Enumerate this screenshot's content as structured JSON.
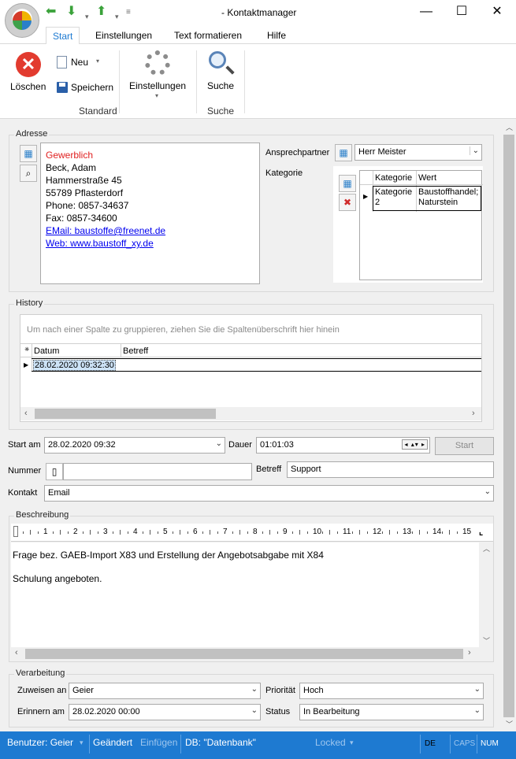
{
  "window": {
    "title": "- Kontaktmanager",
    "minimize": "—",
    "maximize": "☐",
    "close": "✕"
  },
  "quick_access": {
    "back": "⬅",
    "forward": "⬇",
    "up": "⬆",
    "more1": "▾",
    "more2": "▾"
  },
  "ribbon": {
    "tabs": [
      "Start",
      "Einstellungen",
      "Text formatieren",
      "Hilfe"
    ],
    "buttons": {
      "delete": "Löschen",
      "new": "Neu",
      "save": "Speichern",
      "settings": "Einstellungen",
      "search": "Suche"
    },
    "groups": [
      "Standard",
      "Suche"
    ]
  },
  "address": {
    "section_label": "Adresse",
    "lines": {
      "type": "Gewerblich",
      "name": "Beck, Adam",
      "street": "Hammerstraße 45",
      "city": "55789 Pflasterdorf",
      "phone": "Phone: 0857-34637",
      "fax": "Fax: 0857-34600",
      "email": "EMail: baustoffe@freenet.de",
      "web": "Web: www.baustoff_xy.de"
    },
    "type_color": "#e02020",
    "contact_person_label": "Ansprechpartner",
    "contact_person_value": "Herr Meister",
    "category_label": "Kategorie",
    "category_grid": {
      "headers": [
        "Kategorie",
        "Wert"
      ],
      "rows": [
        {
          "kategorie": "Kategorie 2",
          "wert": "Baustoffhandel; Naturstein"
        }
      ]
    }
  },
  "history": {
    "section_label": "History",
    "group_hint": "Um nach einer Spalte zu gruppieren, ziehen Sie die Spaltenüberschrift hier hinein",
    "headers": [
      "Datum",
      "Betreff"
    ],
    "rows": [
      {
        "datum": "28.02.2020 09:32:30",
        "betreff": ""
      }
    ]
  },
  "form": {
    "start_label": "Start am",
    "start_value": "28.02.2020 09:32",
    "duration_label": "Dauer",
    "duration_value": "01:01:03",
    "start_button": "Start",
    "number_label": "Nummer",
    "number_value": "",
    "subject_label": "Betreff",
    "subject_value": "Support",
    "contact_label": "Kontakt",
    "contact_value": "Email"
  },
  "description": {
    "section_label": "Beschreibung",
    "ruler_marks": [
      "1",
      "2",
      "3",
      "4",
      "5",
      "6",
      "7",
      "8",
      "9",
      "10",
      "11",
      "12",
      "13",
      "14",
      "15"
    ],
    "line1": "Frage bez. GAEB-Import X83 und Erstellung der Angebotsabgabe mit X84",
    "line2": "Schulung angeboten."
  },
  "processing": {
    "section_label": "Verarbeitung",
    "assign_label": "Zuweisen an",
    "assign_value": "Geier",
    "priority_label": "Priorität",
    "priority_value": "Hoch",
    "remind_label": "Erinnern am",
    "remind_value": "28.02.2020 00:00",
    "status_label": "Status",
    "status_value": "In Bearbeitung"
  },
  "statusbar": {
    "user": "Benutzer: Geier",
    "changed": "Geändert",
    "insert": "Einfügen",
    "db": "DB: \"Datenbank\"",
    "locked": "Locked",
    "lang": "DE",
    "caps": "CAPS",
    "num": "NUM"
  },
  "colors": {
    "statusbar": "#1e7ad1",
    "accent_tab": "#1e7ad1",
    "link": "#0000ee"
  }
}
